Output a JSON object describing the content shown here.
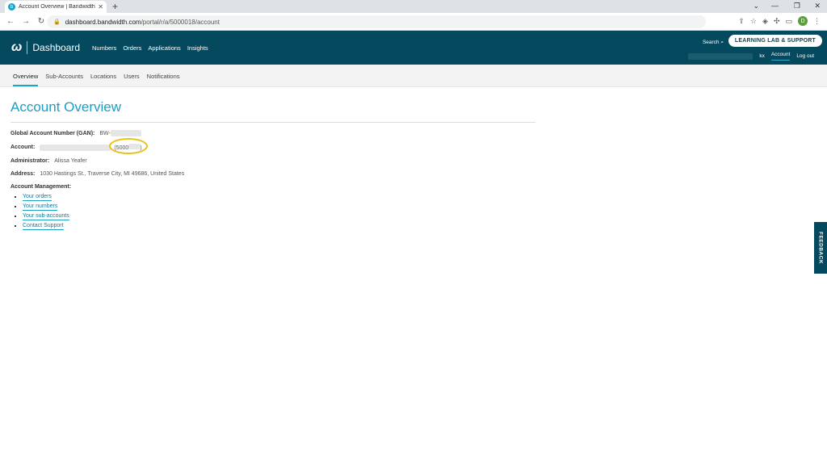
{
  "browser": {
    "tab_title": "Account Overview | Bandwidth D",
    "url_host": "dashboard.bandwidth.com",
    "url_path": "/portal/r/a/5000018/account",
    "profile_initial": "D"
  },
  "header": {
    "brand": "Dashboard",
    "nav": [
      "Numbers",
      "Orders",
      "Applications",
      "Insights"
    ],
    "search": "Search",
    "learning_lab": "LEARNING LAB & SUPPORT",
    "account_link": "Account",
    "logout": "Log out",
    "user_fragment": "kx"
  },
  "subnav": [
    "Overview",
    "Sub-Accounts",
    "Locations",
    "Users",
    "Notifications"
  ],
  "page": {
    "title": "Account Overview",
    "gan_label": "Global Account Number (GAN):",
    "gan_value": "BW-",
    "account_label": "Account:",
    "account_value": "(5000",
    "account_close": ")",
    "admin_label": "Administrator:",
    "admin_value": "Alissa Yeafer",
    "address_label": "Address:",
    "address_value": "1030 Hastings St., Traverse City, MI 49686, United States",
    "management_label": "Account Management:",
    "links": [
      "Your orders",
      "Your numbers",
      "Your sub-accounts",
      "Contact Support"
    ]
  },
  "feedback": "FEEDBACK",
  "colors": {
    "header": "#05495f",
    "accent": "#1ea2c7",
    "highlight": "#e9c21d"
  }
}
